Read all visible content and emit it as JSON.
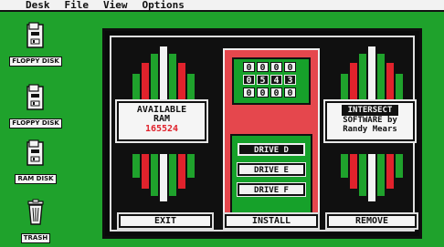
{
  "menubar": {
    "items": [
      "Desk",
      "File",
      "View",
      "Options"
    ]
  },
  "desktop": {
    "icons": [
      {
        "label": "FLOPPY DISK",
        "icon": "floppy-drive-icon"
      },
      {
        "label": "FLOPPY DISK",
        "icon": "floppy-drive-icon"
      },
      {
        "label": "RAM DISK",
        "icon": "ram-disk-icon"
      },
      {
        "label": "TRASH",
        "icon": "trash-icon"
      }
    ]
  },
  "dialog": {
    "available": {
      "line1": "AVAILABLE",
      "line2": "RAM",
      "value": "165524"
    },
    "credits": {
      "badge": "INTERSECT",
      "line1": "SOFTWARE by",
      "line2": "Randy Mears"
    },
    "counter": {
      "row1": [
        "0",
        "0",
        "0",
        "0"
      ],
      "row2": [
        "0",
        "5",
        "4",
        "3"
      ],
      "row3": [
        "0",
        "0",
        "0",
        "0"
      ]
    },
    "drives": [
      {
        "label": "DRIVE D",
        "selected": true
      },
      {
        "label": "DRIVE E",
        "selected": false
      },
      {
        "label": "DRIVE F",
        "selected": false
      }
    ],
    "buttons": {
      "exit": "EXIT",
      "install": "INSTALL",
      "remove": "REMOVE"
    }
  },
  "colors": {
    "desktop": "#1fa22c",
    "accent_red": "#e5474d",
    "bar_green": "#1fa22c",
    "value_red": "#e0222c"
  }
}
